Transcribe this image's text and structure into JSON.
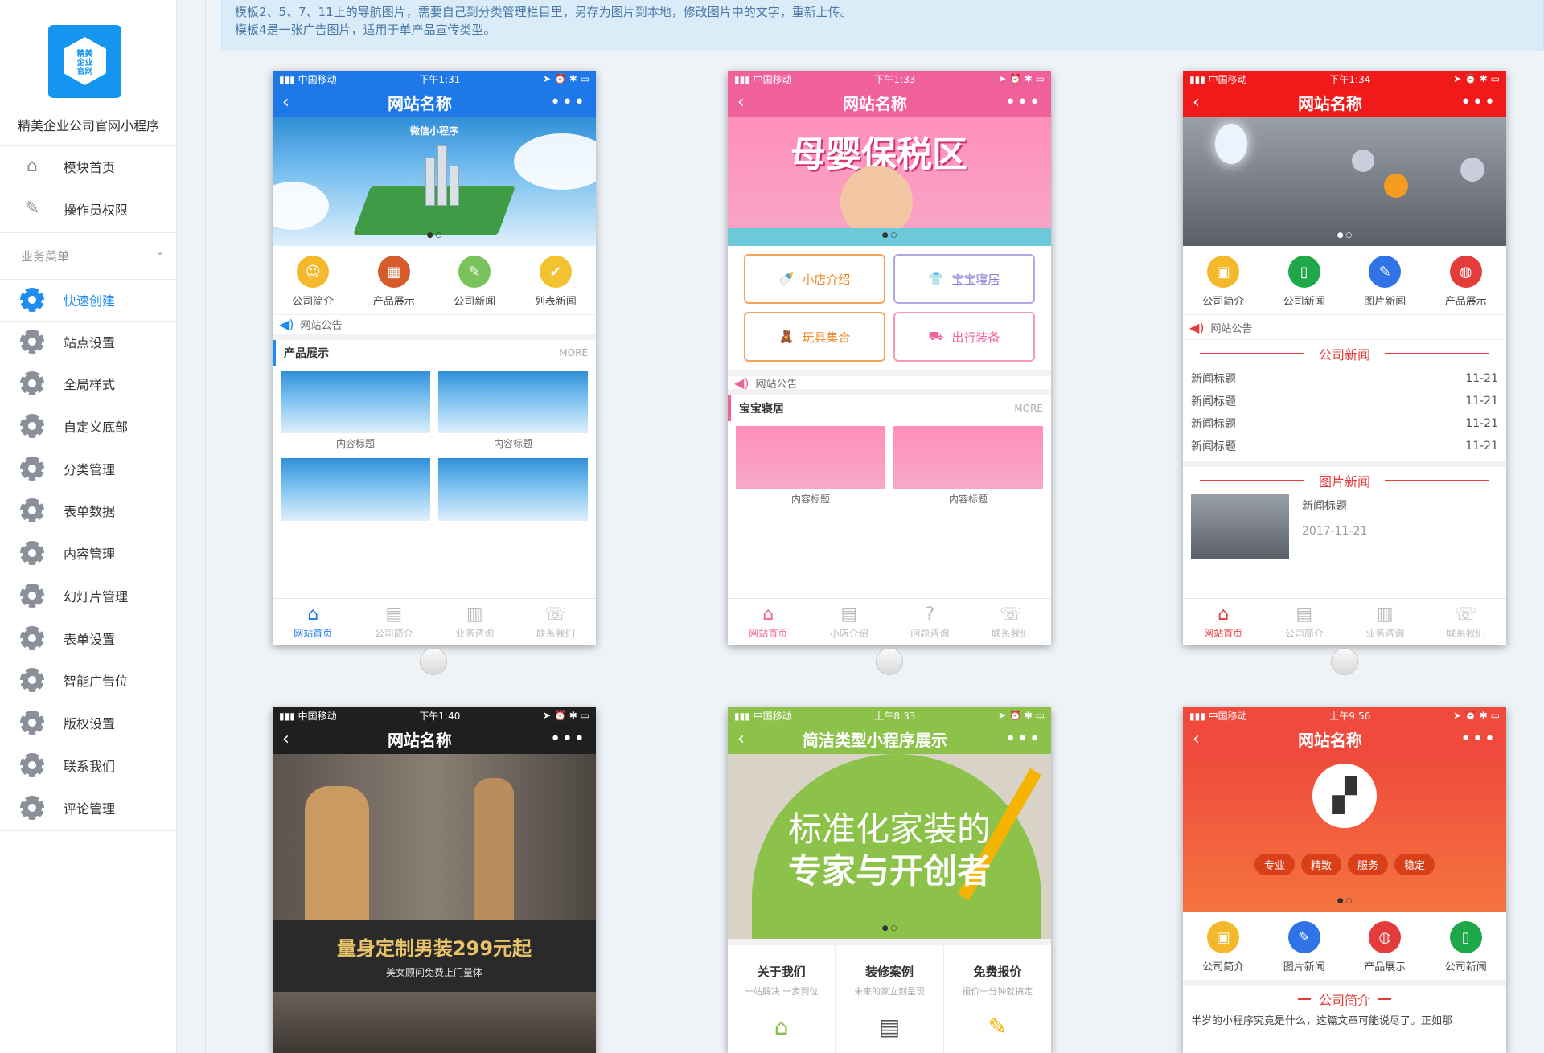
{
  "app": {
    "logo_lines": [
      "精美",
      "企业",
      "官网"
    ],
    "name": "精美企业公司官网小程序"
  },
  "nav_top": [
    {
      "label": "模块首页",
      "icon": "home-icon"
    },
    {
      "label": "操作员权限",
      "icon": "document-edit-icon"
    }
  ],
  "section": {
    "label": "业务菜单",
    "chevron": "chevron-down-icon"
  },
  "nav_items": [
    {
      "label": "快速创建",
      "active": true
    },
    {
      "label": "站点设置"
    },
    {
      "label": "全局样式"
    },
    {
      "label": "自定义底部"
    },
    {
      "label": "分类管理"
    },
    {
      "label": "表单数据"
    },
    {
      "label": "内容管理"
    },
    {
      "label": "幻灯片管理"
    },
    {
      "label": "表单设置"
    },
    {
      "label": "智能广告位"
    },
    {
      "label": "版权设置"
    },
    {
      "label": "联系我们"
    },
    {
      "label": "评论管理"
    }
  ],
  "notice": {
    "line1": "模板2、5、7、11上的导航图片，需要自己到分类管理栏目里，另存为图片到本地，修改图片中的文字，重新上传。",
    "line2": "模板4是一张广告图片，适用于单产品宣传类型。"
  },
  "phones": {
    "p1": {
      "status": {
        "carrier": "中国移动",
        "time": "下午1:31"
      },
      "title": "网站名称",
      "banner_text": "微信小程序",
      "icons": [
        "公司简介",
        "产品展示",
        "公司新闻",
        "列表新闻"
      ],
      "notice": "网站公告",
      "section": "产品展示",
      "more": "MORE",
      "items": [
        "内容标题",
        "内容标题"
      ],
      "tabs": [
        "网站首页",
        "公司简介",
        "业务咨询",
        "联系我们"
      ],
      "accent": "#1f78e8"
    },
    "p2": {
      "status": {
        "carrier": "中国移动",
        "time": "下午1:33"
      },
      "title": "网站名称",
      "banner_text": "母婴保税区",
      "buttons": [
        "小店介绍",
        "宝宝寝居",
        "玩具集合",
        "出行装备"
      ],
      "notice": "网站公告",
      "section": "宝宝寝居",
      "more": "MORE",
      "items": [
        "内容标题",
        "内容标题"
      ],
      "tabs": [
        "网站首页",
        "小店介绍",
        "问题咨询",
        "联系我们"
      ],
      "accent": "#f0619b"
    },
    "p3": {
      "status": {
        "carrier": "中国移动",
        "time": "下午1:34"
      },
      "title": "网站名称",
      "icons": [
        "公司简介",
        "公司新闻",
        "图片新闻",
        "产品展示"
      ],
      "notice": "网站公告",
      "news_title": "公司新闻",
      "news": [
        {
          "t": "新闻标题",
          "d": "11-21"
        },
        {
          "t": "新闻标题",
          "d": "11-21"
        },
        {
          "t": "新闻标题",
          "d": "11-21"
        },
        {
          "t": "新闻标题",
          "d": "11-21"
        }
      ],
      "pic_title": "图片新闻",
      "pic_news": {
        "t": "新闻标题",
        "d": "2017-11-21"
      },
      "tabs": [
        "网站首页",
        "公司简介",
        "业务咨询",
        "联系我们"
      ],
      "accent": "#f11a1a"
    },
    "p4": {
      "status": {
        "carrier": "中国移动",
        "time": "下午1:40"
      },
      "title": "网站名称",
      "ad_main": "量身定制男装299元起",
      "ad_sub": "——美女顾问免费上门量体——",
      "accent": "#1f1f1f"
    },
    "p5": {
      "status": {
        "carrier": "中国移动",
        "time": "上午8:33"
      },
      "title": "简洁类型小程序展示",
      "banner_l1": "标准化家装的",
      "banner_l2": "专家与开创者",
      "cols": [
        {
          "t": "关于我们",
          "s": "一站解决 一步到位"
        },
        {
          "t": "装修案例",
          "s": "未来的家立刻呈现"
        },
        {
          "t": "免费报价",
          "s": "报价一分钟就搞定"
        }
      ],
      "accent": "#8dc24a"
    },
    "p6": {
      "status": {
        "carrier": "中国移动",
        "time": "上午9:56"
      },
      "title": "网站名称",
      "pills": [
        "专业",
        "精致",
        "服务",
        "稳定"
      ],
      "icons": [
        "公司简介",
        "图片新闻",
        "产品展示",
        "公司新闻"
      ],
      "section": "公司简介",
      "intro": "半岁的小程序究竟是什么，这篇文章可能说尽了。正如那",
      "accent": "#ef4a3c"
    }
  }
}
